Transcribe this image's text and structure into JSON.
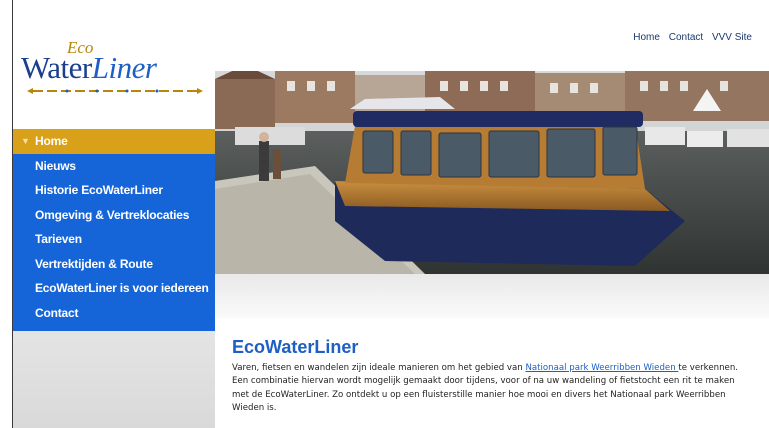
{
  "logo": {
    "eco": "Eco",
    "water": "Water",
    "liner": "Liner"
  },
  "top_nav": [
    "Home",
    "Contact",
    "VVV Site"
  ],
  "sidebar": {
    "items": [
      {
        "label": "Home",
        "active": true
      },
      {
        "label": "Nieuws"
      },
      {
        "label": "Historie EcoWaterLiner"
      },
      {
        "label": "Omgeving & Vertreklocaties"
      },
      {
        "label": "Tarieven"
      },
      {
        "label": "Vertrektijden & Route"
      },
      {
        "label": "EcoWaterLiner is voor iedereen"
      },
      {
        "label": "Contact"
      }
    ]
  },
  "main": {
    "title": "EcoWaterLiner",
    "text_before_link": "Varen, fietsen en wandelen zijn ideale manieren om het gebied van ",
    "link_text": "Nationaal park Weerribben Wieden ",
    "text_after_link": "te verkennen. Een combinatie hiervan wordt mogelijk gemaakt door tijdens, voor of na uw wandeling of fietstocht een rit te maken met de EcoWaterLiner. Zo ontdekt u op een fluisterstille manier hoe mooi en divers het Nationaal park Weerribben Wieden is."
  },
  "colors": {
    "nav_blue": "#1565d8",
    "nav_active": "#d9a019",
    "title_blue": "#1d5fc4"
  }
}
